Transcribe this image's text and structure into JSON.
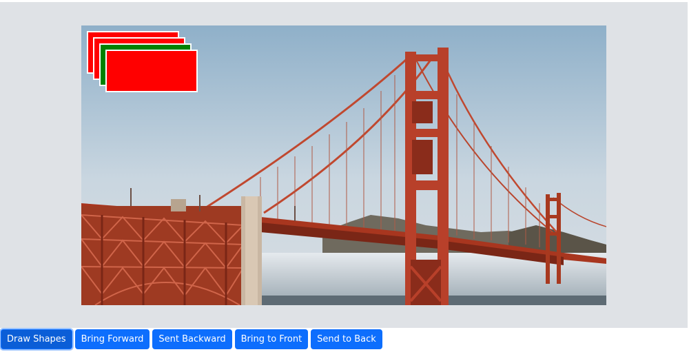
{
  "canvas": {
    "background_color": "#dfe2e6",
    "image_subject": "Golden Gate Bridge photo",
    "shapes": [
      {
        "type": "rectangle",
        "fill": "#ff0000",
        "stroke": "#ffffff"
      },
      {
        "type": "rectangle",
        "fill": "#ff0000",
        "stroke": "#ffffff"
      },
      {
        "type": "rectangle",
        "fill": "#008000",
        "stroke": "#ffffff"
      },
      {
        "type": "rectangle",
        "fill": "#ff0000",
        "stroke": "#ffffff"
      }
    ]
  },
  "toolbar": {
    "accent_color": "#0d6efd",
    "buttons": [
      {
        "label": "Draw Shapes",
        "active": true
      },
      {
        "label": "Bring Forward",
        "active": false
      },
      {
        "label": "Sent Backward",
        "active": false
      },
      {
        "label": "Bring to Front",
        "active": false
      },
      {
        "label": "Send to Back",
        "active": false
      }
    ]
  }
}
